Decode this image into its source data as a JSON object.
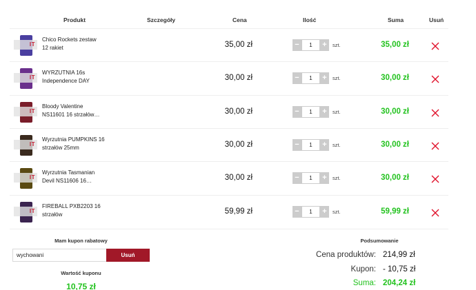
{
  "table": {
    "headers": {
      "produkt": "Produkt",
      "szczegoly": "Szczegóły",
      "cena": "Cena",
      "ilosc": "Ilość",
      "suma": "Suma",
      "usun": "Usuń"
    },
    "rows": [
      {
        "name": "Chico Rockets zestaw\n12 rakiet",
        "price": "35,00 zł",
        "qty": "1",
        "unit": "szt.",
        "sum": "35,00 zł",
        "thumb_color": "#4a3fa0"
      },
      {
        "name": "WYRZUTNIA 16s\nIndependence DAY",
        "price": "30,00 zł",
        "qty": "1",
        "unit": "szt.",
        "sum": "30,00 zł",
        "thumb_color": "#6a2f8c"
      },
      {
        "name": "Bloody Valentine\nNS11601 16 strzałów…",
        "price": "30,00 zł",
        "qty": "1",
        "unit": "szt.",
        "sum": "30,00 zł",
        "thumb_color": "#7a1d2a"
      },
      {
        "name": "Wyrzutnia PUMPKINS 16\nstrzałów 25mm",
        "price": "30,00 zł",
        "qty": "1",
        "unit": "szt.",
        "sum": "30,00 zł",
        "thumb_color": "#3a2a1e"
      },
      {
        "name": "Wyrzutnia Tasmanian\nDevil NS11606 16…",
        "price": "30,00 zł",
        "qty": "1",
        "unit": "szt.",
        "sum": "30,00 zł",
        "thumb_color": "#5a4a12"
      },
      {
        "name": "FIREBALL PXB2203 16\nstrzałów",
        "price": "59,99 zł",
        "qty": "1",
        "unit": "szt.",
        "sum": "59,99 zł",
        "thumb_color": "#3b2450"
      }
    ],
    "qty_minus": "−",
    "qty_plus": "+",
    "watermark": "IT",
    "delete_icon": "close-x-icon"
  },
  "coupon": {
    "title": "Mam kupon rabatowy",
    "input_value": "wychowani",
    "button_label": "Usuń",
    "value_title": "Wartość kuponu",
    "value": "10,75 zł"
  },
  "summary": {
    "title": "Podsumowanie",
    "products_label": "Cena produktów:",
    "products_value": "214,99 zł",
    "coupon_label": "Kupon:",
    "coupon_value": "- 10,75 zł",
    "total_label": "Suma:",
    "total_value": "204,24 zł"
  },
  "colors": {
    "green": "#22c21e",
    "brand_red": "#a11828",
    "delete_red": "#e0102a",
    "qty_button": "#cccccc"
  }
}
